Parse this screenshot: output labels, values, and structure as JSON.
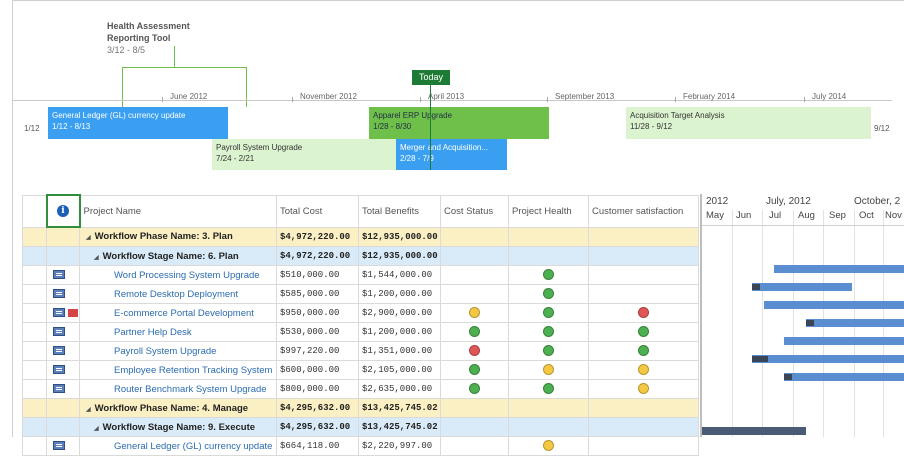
{
  "timeline": {
    "title": "Health Assessment",
    "title2": "Reporting Tool",
    "title_dates": "3/12 - 8/5",
    "today_label": "Today",
    "months": [
      "June 2012",
      "November 2012",
      "April 2013",
      "September 2013",
      "February 2014",
      "July 2014"
    ],
    "left_edge": "1/12",
    "right_edge": "9/12",
    "tasks": [
      {
        "name": "General Ledger (GL) currency update",
        "dates": "1/12 - 8/13"
      },
      {
        "name": "Apparel ERP Upgrade",
        "dates": "1/28 - 8/30"
      },
      {
        "name": "Acquisition Target Analysis",
        "dates": "11/28 - 9/12"
      },
      {
        "name": "Payroll System Upgrade",
        "dates": "7/24 - 2/21"
      },
      {
        "name": "Merger and Acquisition...",
        "dates": "2/28 - 7/9"
      }
    ]
  },
  "grid": {
    "columns": [
      "Project Name",
      "Total Cost",
      "Total Benefits",
      "Cost Status",
      "Project Health",
      "Customer satisfaction"
    ],
    "rows": [
      {
        "kind": "phase",
        "name": "Workflow Phase Name: 3. Plan",
        "cost": "$4,972,220.00",
        "benefits": "$12,935,000.00"
      },
      {
        "kind": "stage",
        "name": "Workflow Stage Name: 6. Plan",
        "cost": "$4,972,220.00",
        "benefits": "$12,935,000.00"
      },
      {
        "kind": "project",
        "name": "Word Processing System Upgrade",
        "cost": "$510,000.00",
        "benefits": "$1,544,000.00",
        "cost_status": "",
        "health": "green",
        "satisfaction": "",
        "flag": false
      },
      {
        "kind": "project",
        "name": "Remote Desktop Deployment",
        "cost": "$585,000.00",
        "benefits": "$1,200,000.00",
        "cost_status": "",
        "health": "green",
        "satisfaction": "",
        "flag": false
      },
      {
        "kind": "project",
        "name": "E-commerce Portal Development",
        "cost": "$950,000.00",
        "benefits": "$2,900,000.00",
        "cost_status": "yellow",
        "health": "green",
        "satisfaction": "red",
        "flag": true
      },
      {
        "kind": "project",
        "name": "Partner Help Desk",
        "cost": "$530,000.00",
        "benefits": "$1,200,000.00",
        "cost_status": "green",
        "health": "green",
        "satisfaction": "green",
        "flag": false
      },
      {
        "kind": "project",
        "name": "Payroll System Upgrade",
        "cost": "$997,220.00",
        "benefits": "$1,351,000.00",
        "cost_status": "red",
        "health": "green",
        "satisfaction": "green",
        "flag": false
      },
      {
        "kind": "project",
        "name": "Employee Retention Tracking System",
        "cost": "$600,000.00",
        "benefits": "$2,105,000.00",
        "cost_status": "green",
        "health": "yellow",
        "satisfaction": "yellow",
        "flag": false
      },
      {
        "kind": "project",
        "name": "Router Benchmark System Upgrade",
        "cost": "$800,000.00",
        "benefits": "$2,635,000.00",
        "cost_status": "green",
        "health": "green",
        "satisfaction": "yellow",
        "flag": false
      },
      {
        "kind": "phase",
        "name": "Workflow Phase Name: 4. Manage",
        "cost": "$4,295,632.00",
        "benefits": "$13,425,745.02"
      },
      {
        "kind": "stage",
        "name": "Workflow Stage Name: 9. Execute",
        "cost": "$4,295,632.00",
        "benefits": "$13,425,745.02"
      },
      {
        "kind": "project",
        "name": "General Ledger (GL) currency update",
        "cost": "$664,118.00",
        "benefits": "$2,220,997.00",
        "cost_status": "",
        "health": "yellow",
        "satisfaction": "",
        "flag": false
      }
    ]
  },
  "gantt": {
    "years": [
      "2012",
      "July, 2012",
      "October, 2"
    ],
    "months": [
      "May",
      "Jun",
      "Jul",
      "Aug",
      "Sep",
      "Oct",
      "Nov"
    ]
  },
  "colors": {
    "accent_blue": "#3a9ff0",
    "accent_green": "#6fbf4b",
    "today_green": "#1d7b35",
    "phase_bg": "#fbf0c4",
    "stage_bg": "#d9ebf9"
  }
}
